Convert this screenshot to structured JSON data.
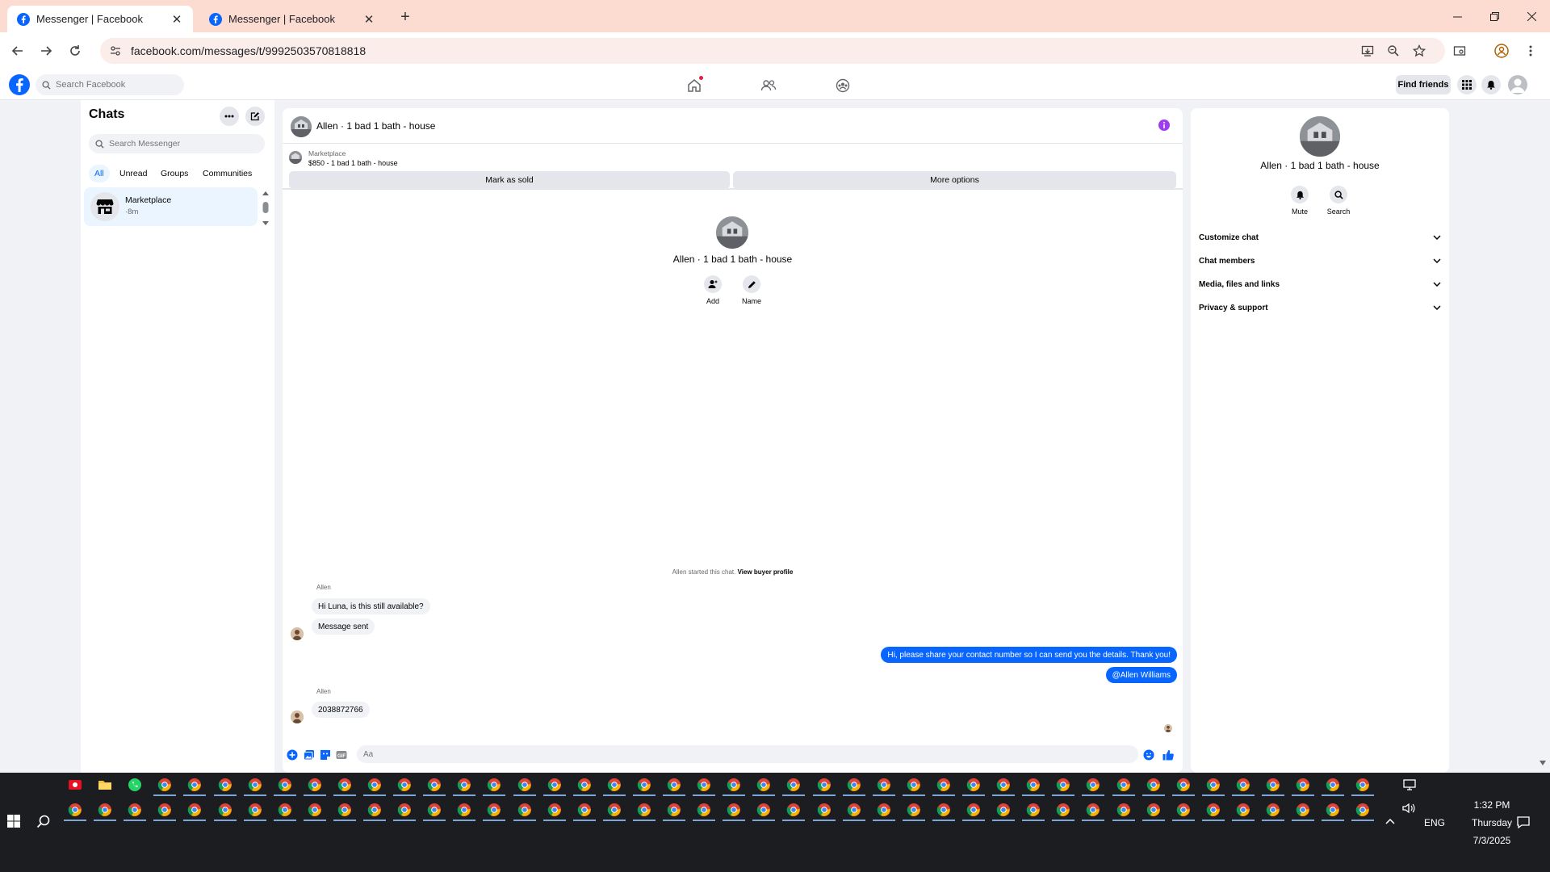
{
  "browser": {
    "tabs": [
      {
        "title": "Messenger | Facebook",
        "active": true
      },
      {
        "title": "Messenger | Facebook",
        "active": false
      }
    ],
    "url": "facebook.com/messages/t/9992503570818818"
  },
  "fb_nav": {
    "search_placeholder": "Search Facebook",
    "find_friends": "Find friends"
  },
  "chats": {
    "title": "Chats",
    "search_placeholder": "Search Messenger",
    "filters": [
      "All",
      "Unread",
      "Groups",
      "Communities"
    ],
    "active_filter": "All",
    "items": [
      {
        "name": "Marketplace",
        "time": "·8m"
      }
    ]
  },
  "conversation": {
    "title": "Allen · 1 bad 1 bath - house",
    "listing": {
      "label": "Marketplace",
      "title": "$850 - 1 bad 1 bath - house",
      "mark_sold": "Mark as sold",
      "more_options": "More options"
    },
    "intro": {
      "name": "Allen · 1 bad 1 bath - house",
      "actions": [
        "Add",
        "Name"
      ]
    },
    "started_text": "Allen started this chat.",
    "started_link": "View buyer profile",
    "messages": [
      {
        "sender": "Allen",
        "text": "Hi Luna, is this still available?",
        "dir": "in"
      },
      {
        "text": "Message sent",
        "dir": "in"
      },
      {
        "text": "Hi, please share your contact number so I can send you the details. Thank you!",
        "dir": "out"
      },
      {
        "text": "@Allen Williams",
        "dir": "out"
      },
      {
        "sender": "Allen",
        "text": "2038872766",
        "dir": "in"
      }
    ],
    "composer_placeholder": "Aa"
  },
  "details": {
    "name": "Allen · 1 bad 1 bath - house",
    "actions": [
      "Mute",
      "Search"
    ],
    "sections": [
      "Customize chat",
      "Chat members",
      "Media, files and links",
      "Privacy & support"
    ]
  },
  "taskbar": {
    "time": "1:32 PM",
    "day": "Thursday",
    "date": "7/3/2025",
    "lang": "ENG"
  },
  "colors": {
    "accent": "#0866ff",
    "tab_strip": "#fcdcd0",
    "info_icon": "#9d3cf1"
  }
}
